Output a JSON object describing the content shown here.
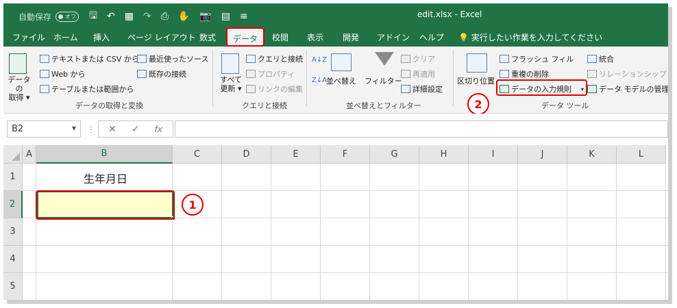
{
  "titlebar": {
    "autosave_label": "自動保存",
    "autosave_state": "オフ",
    "window_title": "edit.xlsx  -  Excel"
  },
  "tabs": [
    {
      "label": "ファイル",
      "active": false
    },
    {
      "label": "ホーム",
      "active": false
    },
    {
      "label": "挿入",
      "active": false
    },
    {
      "label": "ページ レイアウト",
      "active": false
    },
    {
      "label": "数式",
      "active": false
    },
    {
      "label": "データ",
      "active": true
    },
    {
      "label": "校閲",
      "active": false
    },
    {
      "label": "表示",
      "active": false
    },
    {
      "label": "開発",
      "active": false
    },
    {
      "label": "アドイン",
      "active": false
    },
    {
      "label": "ヘルプ",
      "active": false
    },
    {
      "label": "実行したい作業を入力してください",
      "active": false
    }
  ],
  "ribbon": {
    "get_data": {
      "big_line1": "データの",
      "big_line2": "取得 ▾",
      "from_text_csv": "テキストまたは CSV から",
      "from_web": "Web から",
      "from_table": "テーブルまたは範囲から",
      "recent_sources": "最近使ったソース",
      "existing_connections": "既存の接続",
      "group_label": "データの取得と変換"
    },
    "queries": {
      "refresh_line1": "すべて",
      "refresh_line2": "更新 ▾",
      "queries_connections": "クエリと接続",
      "properties": "プロパティ",
      "edit_links": "リンクの編集",
      "group_label": "クエリと接続"
    },
    "sort_filter": {
      "sort": "並べ替え",
      "filter": "フィルター",
      "clear": "クリア",
      "reapply": "再適用",
      "advanced": "詳細設定",
      "group_label": "並べ替えとフィルター"
    },
    "data_tools": {
      "text_to_columns": "区切り位置",
      "flash_fill": "フラッシュ フィル",
      "remove_duplicates": "重複の削除",
      "data_validation": "データの入力規則",
      "consolidate": "統合",
      "relationships": "リレーションシップ",
      "data_model": "データ モデルの管理",
      "group_label": "データ ツール"
    }
  },
  "formula_bar": {
    "name_box": "B2",
    "cancel_glyph": "✕",
    "enter_glyph": "✓",
    "fx_glyph": "fx",
    "formula_value": ""
  },
  "sheet": {
    "columns": [
      "A",
      "B",
      "C",
      "D",
      "E",
      "F",
      "G",
      "H",
      "I",
      "J",
      "K",
      "L"
    ],
    "rows": [
      "1",
      "2",
      "3",
      "4",
      "5"
    ],
    "selected_cell": "B2",
    "b1_value": "生年月日"
  },
  "annotations": {
    "step1": "1",
    "step2": "2",
    "highlight_color": "#e00000"
  },
  "colors": {
    "excel_green": "#217346",
    "selected_fill": "#ffffcc"
  }
}
